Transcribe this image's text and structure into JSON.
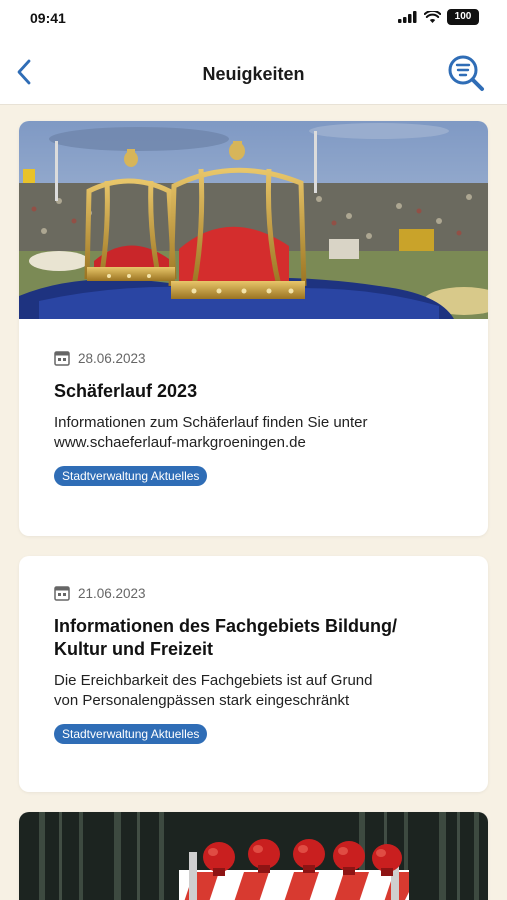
{
  "status": {
    "time": "09:41",
    "battery": "100"
  },
  "nav": {
    "title": "Neuigkeiten"
  },
  "articles": [
    {
      "date": "28.06.2023",
      "title": "Schäferlauf 2023",
      "text_line1": "Informationen zum Schäferlauf finden Sie unter",
      "text_line2": "www.schaeferlauf-markgroeningen.de",
      "tag": "Stadtverwaltung Aktuelles"
    },
    {
      "date": "21.06.2023",
      "title_line1": "Informationen des Fachgebiets Bildung/",
      "title_line2": "Kultur und Freizeit",
      "text_line1": "Die Ereichbarkeit des Fachgebiets ist auf Grund",
      "text_line2": "von Personalengpässen stark eingeschränkt",
      "tag": "Stadtverwaltung Aktuelles"
    }
  ],
  "colors": {
    "accent": "#2f6db6",
    "background": "#f7f1e4",
    "card": "#ffffff"
  },
  "icons": [
    "back-chevron-icon",
    "filter-search-icon",
    "calendar-icon",
    "signal-icon",
    "wifi-icon",
    "battery-icon"
  ]
}
